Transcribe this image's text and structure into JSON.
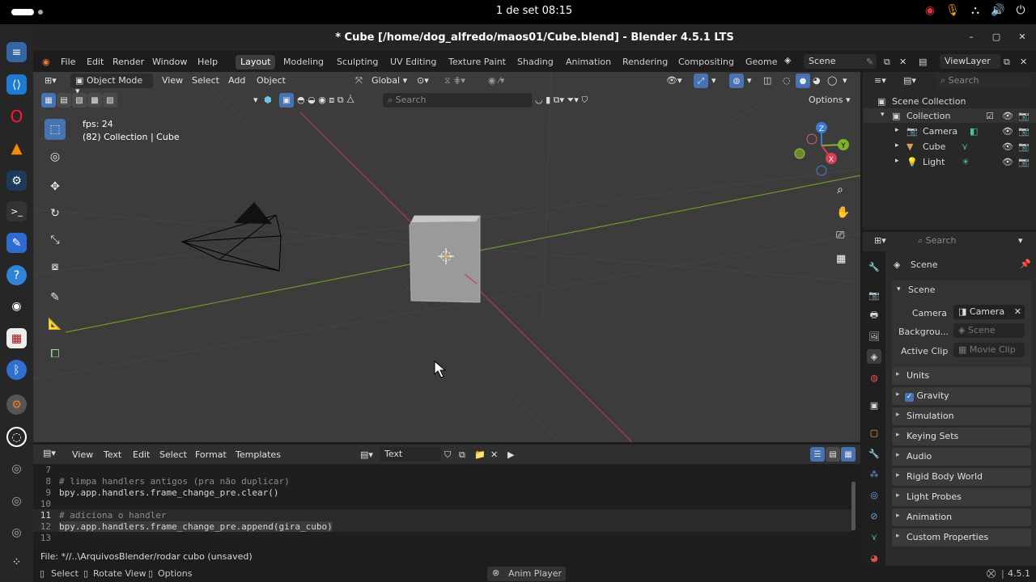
{
  "system": {
    "clock": "1 de set  08:15",
    "tray_icons": [
      "ubuntu-pro-icon",
      "microphone-icon",
      "network-icon",
      "volume-icon",
      "power-icon"
    ]
  },
  "window": {
    "title": "* Cube [/home/dog_alfredo/maos01/Cube.blend] - Blender 4.5.1 LTS"
  },
  "menu": {
    "items": [
      "File",
      "Edit",
      "Render",
      "Window",
      "Help"
    ],
    "workspaces": [
      "Layout",
      "Modeling",
      "Sculpting",
      "UV Editing",
      "Texture Paint",
      "Shading",
      "Animation",
      "Rendering",
      "Compositing",
      "Geome"
    ],
    "active_workspace": "Layout",
    "scene": "Scene",
    "view_layer": "ViewLayer"
  },
  "viewport": {
    "mode": "Object Mode",
    "menus": [
      "View",
      "Select",
      "Add",
      "Object"
    ],
    "orientation": "Global",
    "search_placeholder": "Search",
    "options_label": "Options",
    "fps": "fps: 24",
    "collection_info": "(82) Collection | Cube",
    "gizmo": {
      "z": "Z",
      "y": "Y",
      "x": "X"
    }
  },
  "outliner": {
    "search_placeholder": "Search",
    "scene_collection": "Scene Collection",
    "collection": "Collection",
    "objects": [
      "Camera",
      "Cube",
      "Light"
    ]
  },
  "properties": {
    "search_placeholder": "Search",
    "context": "Scene",
    "panel_scene": "Scene",
    "camera_label": "Camera",
    "camera_value": "Camera",
    "background_label": "Backgrou...",
    "background_value": "Scene",
    "active_clip_label": "Active Clip",
    "active_clip_value": "Movie Clip",
    "panels": [
      "Units",
      "Gravity",
      "Simulation",
      "Keying Sets",
      "Audio",
      "Rigid Body World",
      "Light Probes",
      "Animation",
      "Custom Properties"
    ],
    "gravity_checked": true
  },
  "text_editor": {
    "menus": [
      "View",
      "Text",
      "Edit",
      "Select",
      "Format",
      "Templates"
    ],
    "text_name": "Text",
    "lines": [
      {
        "n": "7",
        "code": ""
      },
      {
        "n": "8",
        "code": "# limpa handlers antigos (pra não duplicar)"
      },
      {
        "n": "9",
        "code": "bpy.app.handlers.frame_change_pre.clear()"
      },
      {
        "n": "10",
        "code": ""
      },
      {
        "n": "11",
        "code": "# adiciona o handler"
      },
      {
        "n": "12",
        "code": "bpy.app.handlers.frame_change_pre.append(gira_cubo)"
      },
      {
        "n": "13",
        "code": ""
      }
    ],
    "file_status": "File: *//..\\ArquivosBlender/rodar cubo (unsaved)"
  },
  "statusbar": {
    "select": "Select",
    "rotate_view": "Rotate View",
    "options": "Options",
    "anim_player": "Anim Player",
    "version": "4.5.1"
  },
  "colors": {
    "accent": "#4772b3",
    "viewport_bg": "#3c3c3c",
    "axis_x": "#c0354a",
    "axis_y": "#6c9a2a"
  }
}
